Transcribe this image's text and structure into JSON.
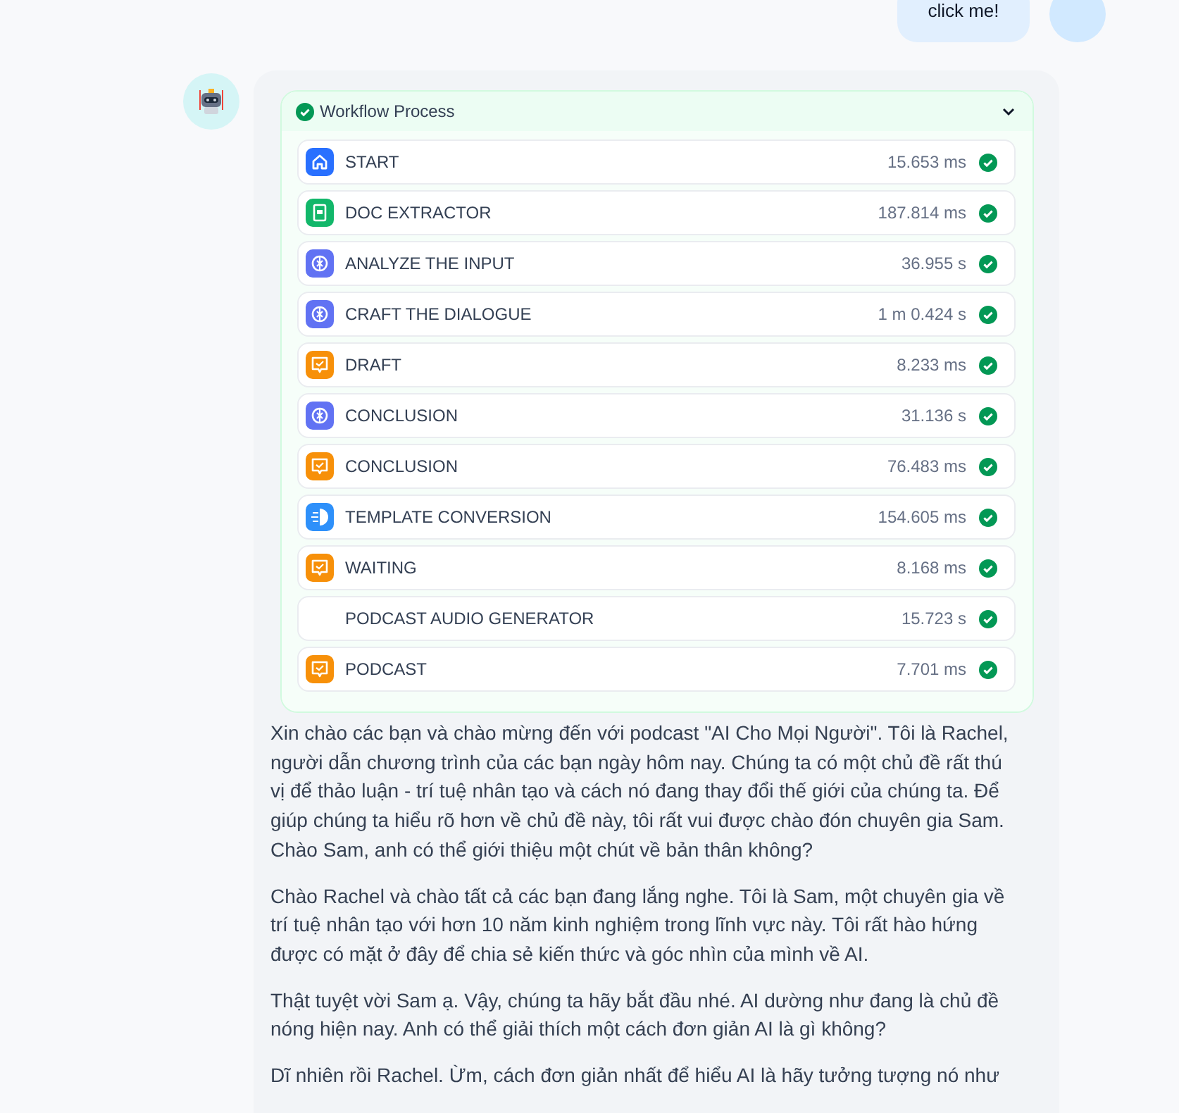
{
  "user_message": {
    "text": "click me!"
  },
  "workflow": {
    "title": "Workflow Process",
    "succeeded": true,
    "expanded": true,
    "nodes": [
      {
        "kind": "start",
        "title": "START",
        "time": "15.653 ms",
        "succeeded": true
      },
      {
        "kind": "doc",
        "title": "DOC EXTRACTOR",
        "time": "187.814 ms",
        "succeeded": true
      },
      {
        "kind": "llm",
        "title": "ANALYZE THE INPUT",
        "time": "36.955 s",
        "succeeded": true
      },
      {
        "kind": "llm",
        "title": "CRAFT THE DIALOGUE",
        "time": "1 m 0.424 s",
        "succeeded": true
      },
      {
        "kind": "answer",
        "title": "DRAFT",
        "time": "8.233 ms",
        "succeeded": true
      },
      {
        "kind": "llm",
        "title": "CONCLUSION",
        "time": "31.136 s",
        "succeeded": true
      },
      {
        "kind": "answer",
        "title": "CONCLUSION",
        "time": "76.483 ms",
        "succeeded": true
      },
      {
        "kind": "template",
        "title": "TEMPLATE CONVERSION",
        "time": "154.605 ms",
        "succeeded": true
      },
      {
        "kind": "answer",
        "title": "WAITING",
        "time": "8.168 ms",
        "succeeded": true
      },
      {
        "kind": "tool",
        "title": "PODCAST AUDIO GENERATOR",
        "time": "15.723 s",
        "succeeded": true
      },
      {
        "kind": "answer",
        "title": "PODCAST",
        "time": "7.701 ms",
        "succeeded": true
      }
    ]
  },
  "paragraphs": [
    "Xin chào các bạn và chào mừng đến với podcast \"AI Cho Mọi Người\". Tôi là Rachel, người dẫn chương trình của các bạn ngày hôm nay. Chúng ta có một chủ đề rất thú vị để thảo luận - trí tuệ nhân tạo và cách nó đang thay đổi thế giới của chúng ta. Để giúp chúng ta hiểu rõ hơn về chủ đề này, tôi rất vui được chào đón chuyên gia Sam. Chào Sam, anh có thể giới thiệu một chút về bản thân không?",
    "Chào Rachel và chào tất cả các bạn đang lắng nghe. Tôi là Sam, một chuyên gia về trí tuệ nhân tạo với hơn 10 năm kinh nghiệm trong lĩnh vực này. Tôi rất hào hứng được có mặt ở đây để chia sẻ kiến thức và góc nhìn của mình về AI.",
    "Thật tuyệt vời Sam ạ. Vậy, chúng ta hãy bắt đầu nhé. AI dường như đang là chủ đề nóng hiện nay. Anh có thể giải thích một cách đơn giản AI là gì không?",
    "Dĩ nhiên rồi Rachel. Ừm, cách đơn giản nhất để hiểu AI là hãy tưởng tượng nó như"
  ]
}
